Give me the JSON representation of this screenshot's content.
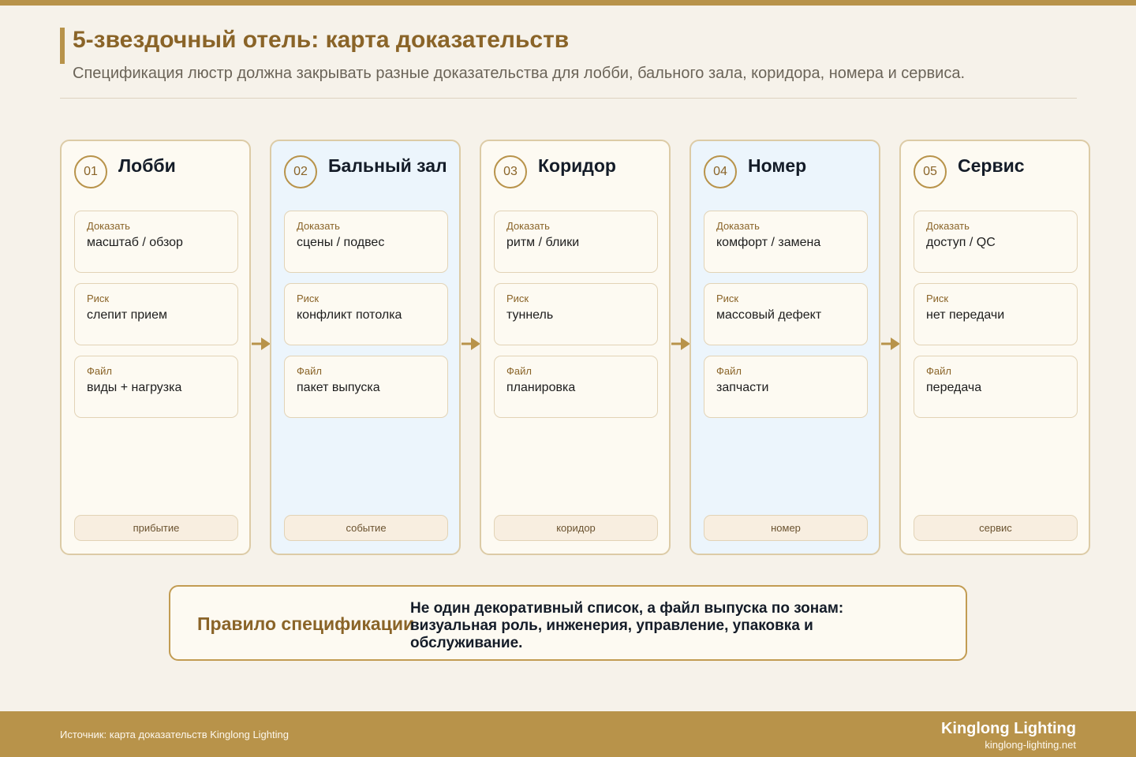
{
  "header": {
    "title": "5-звездочный отель: карта доказательств",
    "subtitle": "Спецификация люстр должна закрывать разные доказательства для лобби, бального зала, коридора, номера и сервиса."
  },
  "columns": [
    {
      "num": "01",
      "title": "Лобби",
      "cards": [
        {
          "label": "Доказать",
          "value": "масштаб / обзор"
        },
        {
          "label": "Риск",
          "value": "слепит прием"
        },
        {
          "label": "Файл",
          "value": "виды + нагрузка"
        }
      ],
      "zone": "прибытие"
    },
    {
      "num": "02",
      "title": "Бальный зал",
      "cards": [
        {
          "label": "Доказать",
          "value": "сцены / подвес"
        },
        {
          "label": "Риск",
          "value": "конфликт потолка"
        },
        {
          "label": "Файл",
          "value": "пакет выпуска"
        }
      ],
      "zone": "событие"
    },
    {
      "num": "03",
      "title": "Коридор",
      "cards": [
        {
          "label": "Доказать",
          "value": "ритм / блики"
        },
        {
          "label": "Риск",
          "value": "туннель"
        },
        {
          "label": "Файл",
          "value": "планировка"
        }
      ],
      "zone": "коридор"
    },
    {
      "num": "04",
      "title": "Номер",
      "cards": [
        {
          "label": "Доказать",
          "value": "комфорт / замена"
        },
        {
          "label": "Риск",
          "value": "массовый дефект"
        },
        {
          "label": "Файл",
          "value": "запчасти"
        }
      ],
      "zone": "номер"
    },
    {
      "num": "05",
      "title": "Сервис",
      "cards": [
        {
          "label": "Доказать",
          "value": "доступ / QC"
        },
        {
          "label": "Риск",
          "value": "нет передачи"
        },
        {
          "label": "Файл",
          "value": "передача"
        }
      ],
      "zone": "сервис"
    }
  ],
  "rule": {
    "title": "Правило спецификации",
    "text": "Не один декоративный список, а файл выпуска по зонам: визуальная роль, инженерия, управление, упаковка и обслуживание."
  },
  "footer": {
    "source": "Источник: карта доказательств Kinglong Lighting",
    "brand": "Kinglong Lighting",
    "url": "kinglong-lighting.net"
  },
  "colors": {
    "accent": "#b8934a",
    "accent_dark": "#8a6428",
    "background": "#f6f2ea",
    "card_bg": "#fdfaf2",
    "alt_column_bg": "#ecf5fc"
  }
}
